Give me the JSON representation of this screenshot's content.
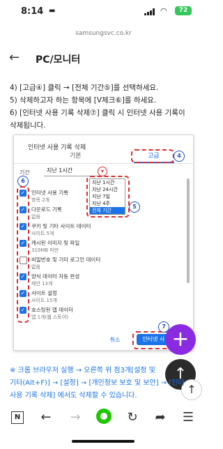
{
  "status": {
    "time": "8:14",
    "battery": "72"
  },
  "url": "samsungsvc.co.kr",
  "header": {
    "title": "PC/모니터"
  },
  "steps": [
    "4) [고급④] 클릭 → [전체 기간⑤]를 선택하세요.",
    "5) 삭제하고자 하는 항목에 [V체크⑥]를 하세요.",
    "6) [인터넷 사용 기록 삭제⑦] 클릭 시 인터넷 사용 기록이",
    "삭제됩니다."
  ],
  "dialog": {
    "title": "인터넷 사용 기록 삭제",
    "tab_basic": "기본",
    "tab_advanced": "고급",
    "range_label": "기간",
    "range_value": "지난 1시간",
    "options": [
      "지난 1시간",
      "지난 24시간",
      "지난 7일",
      "지난 4주",
      "전체 기간"
    ],
    "items": [
      {
        "title": "인터넷 사용 기록",
        "sub": "항목 2개",
        "checked": true
      },
      {
        "title": "다운로드 기록",
        "sub": "없음",
        "checked": true
      },
      {
        "title": "쿠키 및 기타 사이트 데이터",
        "sub": "사이트 5개",
        "checked": true
      },
      {
        "title": "캐시된 이미지 및 파일",
        "sub": "319MB 미만",
        "checked": true
      },
      {
        "title": "비밀번호 및 기타 로그인 데이터",
        "sub": "없음",
        "checked": false
      },
      {
        "title": "양식 데이터 자동 완성",
        "sub": "제안 13개",
        "checked": true
      },
      {
        "title": "사이트 설정",
        "sub": "사이트 15개",
        "checked": true
      },
      {
        "title": "호스팅된 앱 데이터",
        "sub": "앱 1개(웹 스토어)",
        "checked": true
      }
    ],
    "cancel": "취소",
    "delete": "인터넷 사용"
  },
  "markers": {
    "m4": "4",
    "m5": "5",
    "m6": "6",
    "m7": "7"
  },
  "note": [
    "※ 크롬 브라우저 실행 → 오른쪽 위 점3개[설정 및",
    "기타(Alt+F)] → [설정] → [개인정보 보호 및 보안] → [인터",
    "사용 기록 삭제] 에서도 삭제할 수 있습니다."
  ],
  "bottom": {
    "n_label": "N"
  },
  "icons": [
    "home-icon",
    "back-icon",
    "forward-icon",
    "refresh-icon",
    "share-icon",
    "menu-icon"
  ],
  "colors": {
    "accent": "#1a73e8",
    "highlight": "#e02b2b",
    "fab": "#8a2be2"
  }
}
